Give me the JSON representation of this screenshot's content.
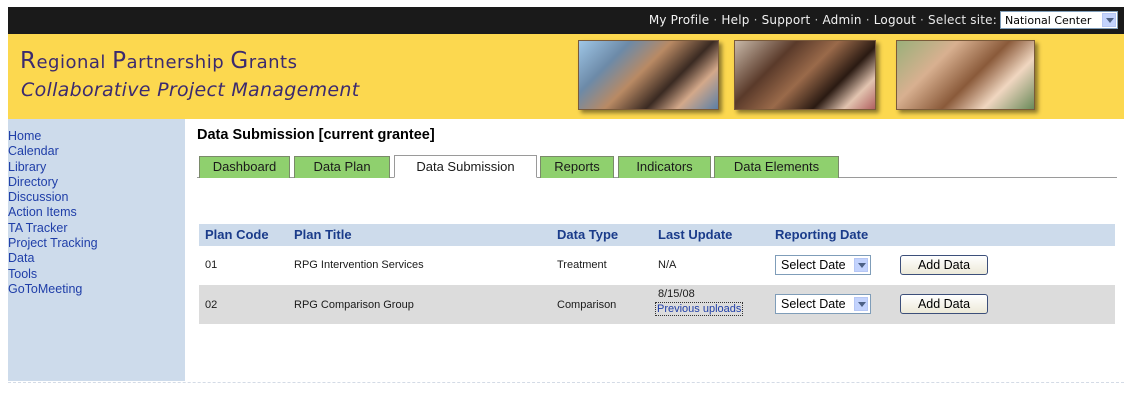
{
  "topbar": {
    "links": [
      "My Profile",
      "Help",
      "Support",
      "Admin",
      "Logout"
    ],
    "select_site_label": "Select site:",
    "site_value": "National Center"
  },
  "header": {
    "brand_line1": {
      "r": "R",
      "egional": "egional ",
      "p": "P",
      "artnership": "artnership ",
      "g": "G",
      "rants": "rants"
    },
    "brand_line2": "Collaborative Project Management"
  },
  "sidebar": {
    "items": [
      "Home",
      "Calendar",
      "Library",
      "Directory",
      "Discussion",
      "Action Items",
      "TA Tracker",
      "Project Tracking",
      "Data",
      "Tools",
      "GoToMeeting"
    ]
  },
  "page": {
    "title": "Data Submission [current grantee]"
  },
  "tabs": [
    "Dashboard",
    "Data Plan",
    "Data Submission",
    "Reports",
    "Indicators",
    "Data Elements"
  ],
  "active_tab": "Data Submission",
  "table": {
    "headers": [
      "Plan Code",
      "Plan Title",
      "Data Type",
      "Last Update",
      "Reporting Date"
    ],
    "rows": [
      {
        "code": "01",
        "title": "RPG Intervention Services",
        "type": "Treatment",
        "last_update": "N/A",
        "previous_link": "",
        "select_value": "Select Date",
        "button": "Add Data"
      },
      {
        "code": "02",
        "title": "RPG Comparison Group",
        "type": "Comparison",
        "last_update": "8/15/08",
        "previous_link": "Previous uploads",
        "select_value": "Select Date",
        "button": "Add Data"
      }
    ]
  },
  "colors": {
    "topbar": "#1a1a1a",
    "header": "#fcd84f",
    "brand": "#3b2a6f",
    "sidebar": "#cddbeb",
    "link": "#1f3ea8",
    "tab": "#8fd06e",
    "table_header": "#cddbeb",
    "alt_row": "#dcdcdc"
  },
  "icons": [
    "chevron-down-icon"
  ]
}
